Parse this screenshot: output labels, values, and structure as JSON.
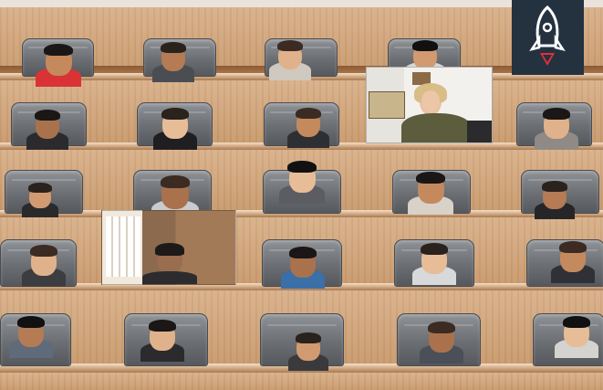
{
  "window": {
    "title": ""
  },
  "colors": {
    "wood": "#cfa57c",
    "seat": "#74777b",
    "logo_bg": "#243240",
    "logo_accent": "#e0303a"
  },
  "logo": {
    "icon": "rocket-icon"
  },
  "participants": [
    {
      "id": "p1",
      "row": 1,
      "shirt": "#d93336"
    },
    {
      "id": "p2",
      "row": 1,
      "shirt": "#4a4d52"
    },
    {
      "id": "p3",
      "row": 1,
      "shirt": "#cfc9c0"
    },
    {
      "id": "p4",
      "row": 1,
      "shirt": "#d7d8d6"
    },
    {
      "id": "p5",
      "row": 2,
      "shirt": "#2b2b2e"
    },
    {
      "id": "p6",
      "row": 2,
      "shirt": "#1f1f22"
    },
    {
      "id": "p7",
      "row": 2,
      "shirt": "#2d2f33"
    },
    {
      "id": "p8",
      "row": 2,
      "shirt": "#5b5d3c",
      "video": true
    },
    {
      "id": "p9",
      "row": 2,
      "shirt": "#8f8a85"
    },
    {
      "id": "p10",
      "row": 3,
      "shirt": "#2a2a2d"
    },
    {
      "id": "p11",
      "row": 3,
      "shirt": "#c9cbcd"
    },
    {
      "id": "p12",
      "row": 3,
      "shirt": "#5b5d63"
    },
    {
      "id": "p13",
      "row": 3,
      "shirt": "#d9d2c8"
    },
    {
      "id": "p14",
      "row": 3,
      "shirt": "#262629"
    },
    {
      "id": "p15",
      "row": 4,
      "shirt": "#3c3d41"
    },
    {
      "id": "p16",
      "row": 4,
      "shirt": "#2c2c2f",
      "video": true
    },
    {
      "id": "p17",
      "row": 4,
      "shirt": "#3b6fa8"
    },
    {
      "id": "p18",
      "row": 4,
      "shirt": "#d7d9db"
    },
    {
      "id": "p19",
      "row": 4,
      "shirt": "#2f3136"
    },
    {
      "id": "p20",
      "row": 5,
      "shirt": "#5f6b7a"
    },
    {
      "id": "p21",
      "row": 5,
      "shirt": "#2b2b2e"
    },
    {
      "id": "p22",
      "row": 5,
      "shirt": "#3a3a3d"
    },
    {
      "id": "p23",
      "row": 5,
      "shirt": "#4a4f58"
    },
    {
      "id": "p24",
      "row": 5,
      "shirt": "#d5d3cf"
    }
  ]
}
